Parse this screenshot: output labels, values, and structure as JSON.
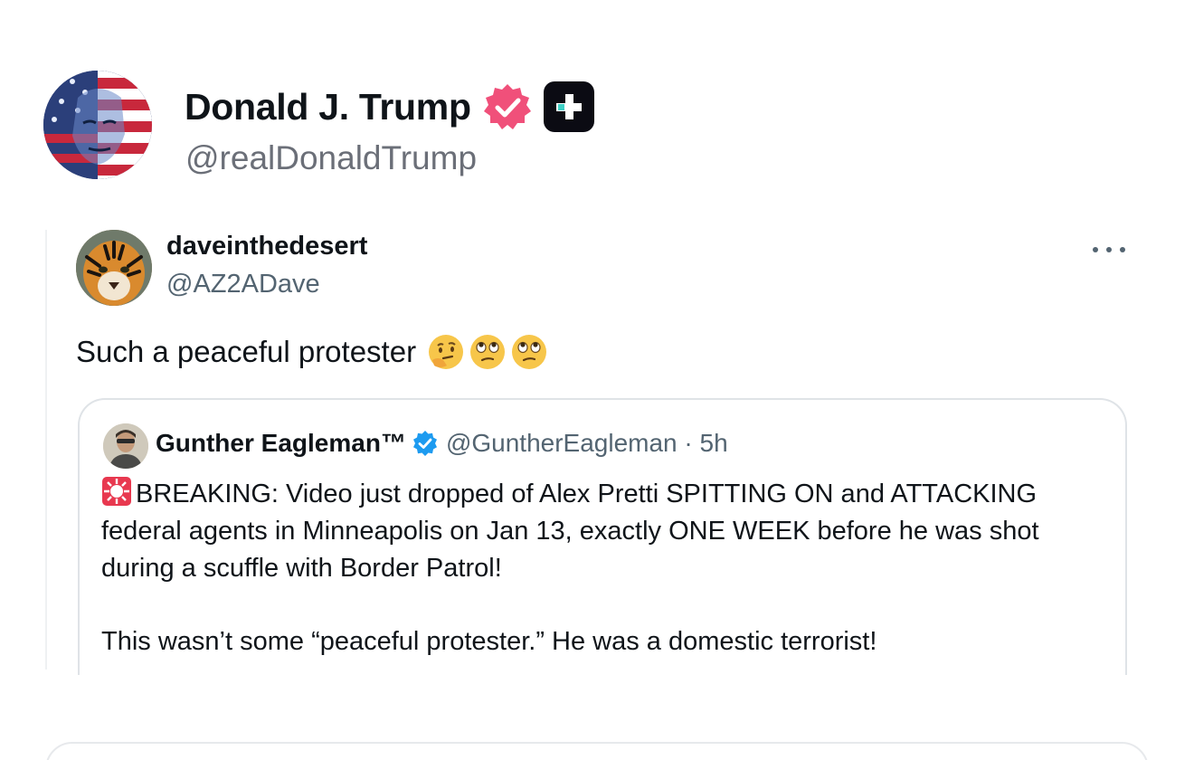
{
  "post": {
    "author_name": "Donald J. Trump",
    "author_handle": "@realDonaldTrump",
    "avatar_icon": "flag-portrait-avatar",
    "verified_icon": "verified-badge-icon",
    "plus_icon": "plus-badge-icon",
    "colors": {
      "verified": "#f0507a",
      "plus_bg": "#0b0b13",
      "plus_accent": "#3fd1c6"
    }
  },
  "embed": {
    "name": "daveinthedesert",
    "handle": "@AZ2ADave",
    "avatar_icon": "tiger-avatar",
    "more_icon": "more-options-icon",
    "text": "Such a peaceful protester",
    "emojis": [
      "thinking-face-emoji",
      "eye-roll-emoji",
      "eye-roll-emoji"
    ]
  },
  "quote": {
    "name": "Gunther Eagleman™",
    "handle": "@GuntherEagleman · 5h",
    "verified_icon": "blue-verified-icon",
    "siren_icon": "siren-emoji",
    "paragraph_1": "BREAKING: Video just dropped of Alex Pretti SPITTING ON and ATTACKING federal agents in Minneapolis on Jan 13, exactly ONE WEEK before he was shot during a scuffle with Border Patrol!",
    "paragraph_2": "This wasn’t some “peaceful protester.” He was a domestic terrorist!",
    "colors": {
      "verified": "#1d9bf0"
    }
  }
}
